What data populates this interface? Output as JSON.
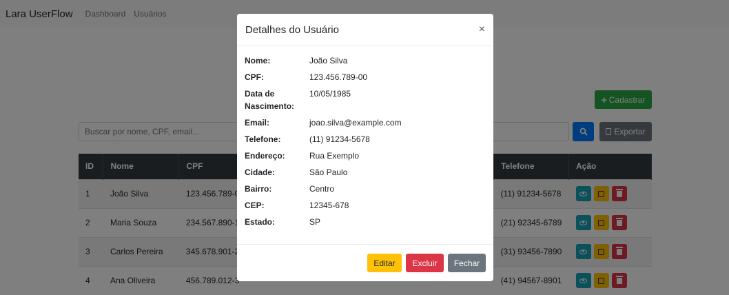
{
  "navbar": {
    "brand": "Lara UserFlow",
    "links": [
      "Dashboard",
      "Usuários"
    ]
  },
  "toolbar": {
    "cadastrar_label": "Cadastrar",
    "search_placeholder": "Buscar por nome, CPF, email...",
    "search_icon": "search-icon",
    "export_label": "Exportar"
  },
  "table": {
    "headers": [
      "ID",
      "Nome",
      "CPF",
      "",
      "",
      "Telefone",
      "Ação"
    ],
    "rows": [
      {
        "id": "1",
        "nome": "João Silva",
        "cpf": "123.456.789-0",
        "telefone": "(11) 91234-5678"
      },
      {
        "id": "2",
        "nome": "Maria Souza",
        "cpf": "234.567.890-1",
        "telefone": "(21) 92345-6789"
      },
      {
        "id": "3",
        "nome": "Carlos Pereira",
        "cpf": "345.678.901-2",
        "telefone": "(31) 93456-7890"
      },
      {
        "id": "4",
        "nome": "Ana Oliveira",
        "cpf": "456.789.012-3",
        "telefone": "(41) 94567-8901"
      }
    ],
    "action_icons": [
      "eye-icon",
      "edit-icon",
      "trash-icon"
    ]
  },
  "modal": {
    "title": "Detalhes do Usuário",
    "close_glyph": "×",
    "fields": [
      {
        "label": "Nome:",
        "value": "João Silva"
      },
      {
        "label": "CPF:",
        "value": "123.456.789-00"
      },
      {
        "label": "Data de Nascimento:",
        "value": "10/05/1985"
      },
      {
        "label": "Email:",
        "value": "joao.silva@example.com"
      },
      {
        "label": "Telefone:",
        "value": "(11) 91234-5678"
      },
      {
        "label": "Endereço:",
        "value": "Rua Exemplo"
      },
      {
        "label": "Cidade:",
        "value": "São Paulo"
      },
      {
        "label": "Bairro:",
        "value": "Centro"
      },
      {
        "label": "CEP:",
        "value": "12345-678"
      },
      {
        "label": "Estado:",
        "value": "SP"
      }
    ],
    "buttons": {
      "editar": "Editar",
      "excluir": "Excluir",
      "fechar": "Fechar"
    }
  },
  "colors": {
    "primary": "#007bff",
    "success": "#28a745",
    "warning": "#ffc107",
    "danger": "#dc3545",
    "secondary": "#6c757d",
    "info": "#17a2b8",
    "dark": "#343a40"
  }
}
